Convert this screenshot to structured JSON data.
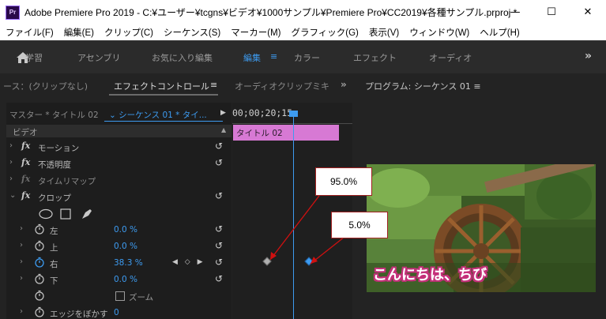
{
  "titlebar": {
    "app_icon": "Pr",
    "title": "Adobe Premiere Pro 2019 - C:¥ユーザー¥tcgns¥ビデオ¥1000サンプル¥Premiere Pro¥CC2019¥各種サンプル.prproj *",
    "minimize": "—",
    "maximize": "☐",
    "close": "✕"
  },
  "menu": [
    "ファイル(F)",
    "編集(E)",
    "クリップ(C)",
    "シーケンス(S)",
    "マーカー(M)",
    "グラフィック(G)",
    "表示(V)",
    "ウィンドウ(W)",
    "ヘルプ(H)"
  ],
  "workspace": {
    "home": "学習",
    "tabs": [
      "アセンブリ",
      "お気に入り編集",
      "編集",
      "カラー",
      "エフェクト",
      "オーディオ"
    ],
    "active_tab": "編集",
    "menu_glyph": "≡",
    "more": "»"
  },
  "panel_tabs": {
    "source": "ース：(クリップなし)",
    "effect_controls": "エフェクトコントロール",
    "menu_glyph": "≡",
    "audio_mixer": "オーディオクリップミキ",
    "more": "»"
  },
  "effect_controls": {
    "master": "マスター * タイトル 02",
    "sequence": "シーケンス 01 * タイ...",
    "video_header": "ビデオ",
    "effects": [
      {
        "name": "モーション"
      },
      {
        "name": "不透明度"
      },
      {
        "name": "タイムリマップ"
      },
      {
        "name": "クロップ"
      }
    ],
    "properties": [
      {
        "name": "左",
        "value": "0.0 %"
      },
      {
        "name": "上",
        "value": "0.0 %"
      },
      {
        "name": "右",
        "value": "38.3 %"
      },
      {
        "name": "下",
        "value": "0.0 %"
      }
    ],
    "zoom_label": "ズーム",
    "feather_label": "エッジをぼかす",
    "feather_value": "0",
    "kf_nav": "◀ ◇ ▶",
    "reset_glyph": "↺",
    "fx": "fx"
  },
  "timeline": {
    "timecode": "00;00;20;15",
    "clip_label": "タイトル 02"
  },
  "program": {
    "title": "プログラム: シーケンス 01",
    "menu_glyph": "≡",
    "subtitle": "こんにちは、ちび"
  },
  "callouts": {
    "a": "95.0%",
    "b": "5.0%"
  },
  "colors": {
    "accent": "#3d9bf0",
    "clip": "#d779d4",
    "callout_border": "#a02020"
  }
}
